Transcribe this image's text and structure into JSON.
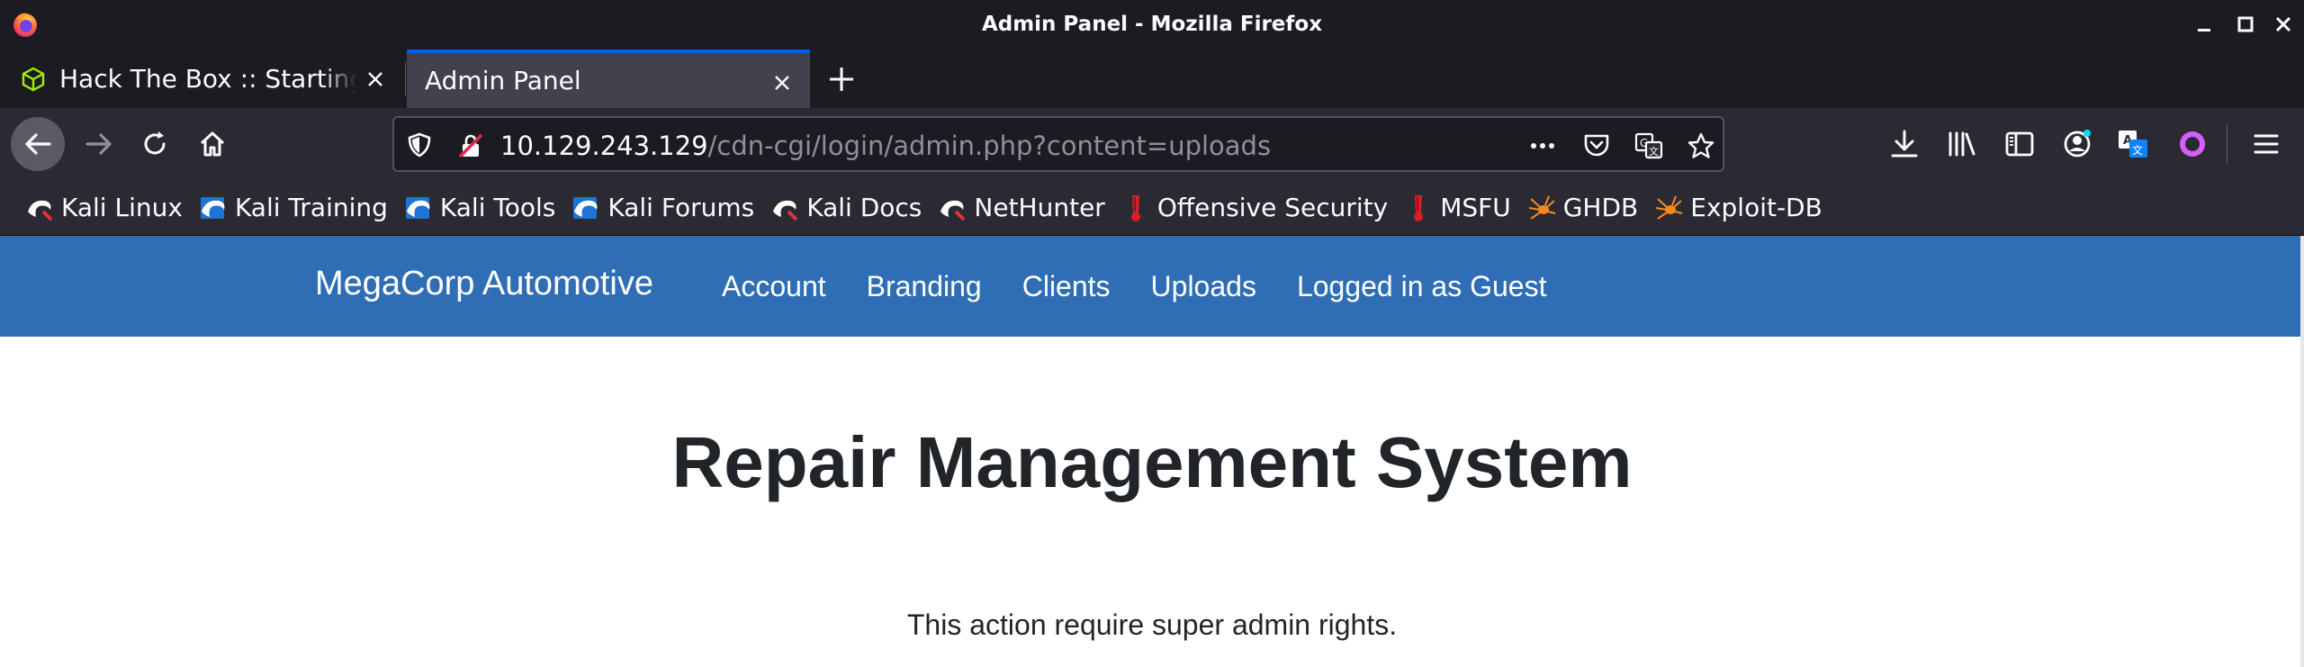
{
  "window": {
    "title": "Admin Panel - Mozilla Firefox"
  },
  "tabs": [
    {
      "label": "Hack The Box :: Starting Point",
      "active": false
    },
    {
      "label": "Admin Panel",
      "active": true
    }
  ],
  "urlbar": {
    "host": "10.129.243.129",
    "path": "/cdn-cgi/login/admin.php?content=uploads"
  },
  "bookmarks": [
    {
      "label": "Kali Linux",
      "icon": "kali-dragon-icon"
    },
    {
      "label": "Kali Training",
      "icon": "kali-dragon-icon"
    },
    {
      "label": "Kali Tools",
      "icon": "kali-dragon-icon"
    },
    {
      "label": "Kali Forums",
      "icon": "kali-dragon-icon"
    },
    {
      "label": "Kali Docs",
      "icon": "kali-dragon-icon"
    },
    {
      "label": "NetHunter",
      "icon": "kali-dragon-icon"
    },
    {
      "label": "Offensive Security",
      "icon": "offsec-icon"
    },
    {
      "label": "MSFU",
      "icon": "offsec-icon"
    },
    {
      "label": "GHDB",
      "icon": "exploitdb-spider-icon"
    },
    {
      "label": "Exploit-DB",
      "icon": "exploitdb-spider-icon"
    }
  ],
  "site": {
    "brand": "MegaCorp Automotive",
    "menu": [
      "Account",
      "Branding",
      "Clients",
      "Uploads",
      "Logged in as Guest"
    ],
    "heading": "Repair Management System",
    "message": "This action require super admin rights."
  },
  "colors": {
    "chrome_dark": "#1c1b22",
    "toolbar": "#2b2a33",
    "active_tab": "#42414d",
    "site_nav": "#2f6eb5"
  }
}
